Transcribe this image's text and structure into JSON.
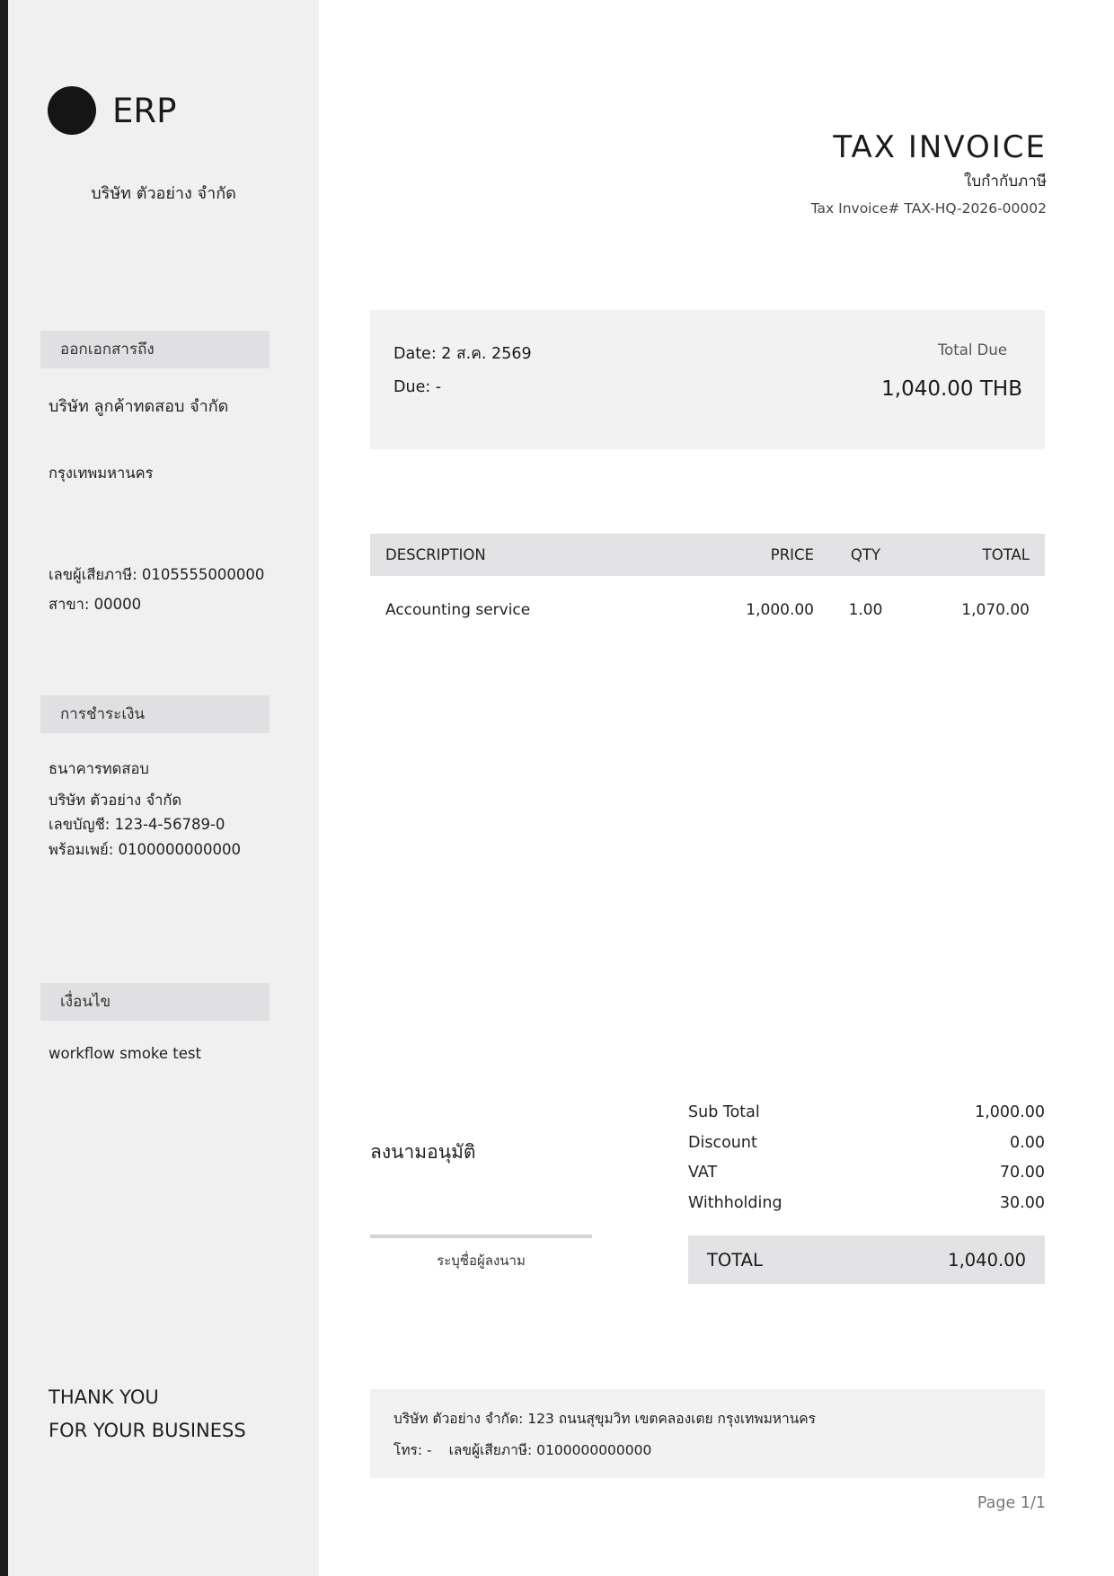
{
  "logo_text": "ERP",
  "company_name": "บริษัท ตัวอย่าง จำกัด",
  "bill_to": {
    "heading": "ออกเอกสารถึง",
    "name": "บริษัท ลูกค้าทดสอบ จำกัด",
    "address": "กรุงเทพมหานคร",
    "tax_id": "เลขผู้เสียภาษี: 0105555000000",
    "branch": "สาขา: 00000"
  },
  "payment": {
    "heading": "การชำระเงิน",
    "bank": "ธนาคารทดสอบ",
    "account_name": "บริษัท ตัวอย่าง จำกัด",
    "account_no": "เลขบัญชี: 123-4-56789-0",
    "promptpay": "พร้อมเพย์: 0100000000000"
  },
  "conditions": {
    "heading": "เงื่อนไข",
    "text": "workflow smoke test"
  },
  "thank_you": {
    "line1": "THANK YOU",
    "line2": "FOR YOUR BUSINESS"
  },
  "document": {
    "title": "TAX INVOICE",
    "subtitle": "ใบกำกับภาษี",
    "number": "Tax Invoice# TAX-HQ-2026-00002"
  },
  "summary": {
    "date": "Date: 2 ส.ค. 2569",
    "due": "Due: -",
    "total_due_label": "Total Due",
    "total_due_value": "1,040.00 THB"
  },
  "items": {
    "columns": [
      "DESCRIPTION",
      "PRICE",
      "QTY",
      "TOTAL"
    ],
    "rows": [
      [
        "Accounting service",
        "1,000.00",
        "1.00",
        "1,070.00"
      ]
    ]
  },
  "signature": {
    "title": "ลงนามอนุมัติ",
    "placeholder": "ระบุชื่อผู้ลงนาม"
  },
  "totals": [
    {
      "label": "Sub Total",
      "value": "1,000.00"
    },
    {
      "label": "Discount",
      "value": "0.00"
    },
    {
      "label": "VAT",
      "value": "70.00"
    },
    {
      "label": "Withholding",
      "value": "30.00"
    }
  ],
  "grand_total": {
    "label": "TOTAL",
    "value": "1,040.00"
  },
  "footer": {
    "address": "บริษัท ตัวอย่าง จำกัด: 123 ถนนสุขุมวิท เขตคลองเตย กรุงเทพมหานคร",
    "phone": "โทร: -",
    "tax_id": "เลขผู้เสียภาษี: 0100000000000"
  },
  "page": "Page 1/1",
  "colors": {
    "sidebar_bg": "#f0f0f1",
    "section_header_bg": "#e0e0e2",
    "summary_bg": "#f2f2f3",
    "table_header_bg": "#e3e3e5",
    "logo": "#151515",
    "edge": "#1c1c1e"
  }
}
